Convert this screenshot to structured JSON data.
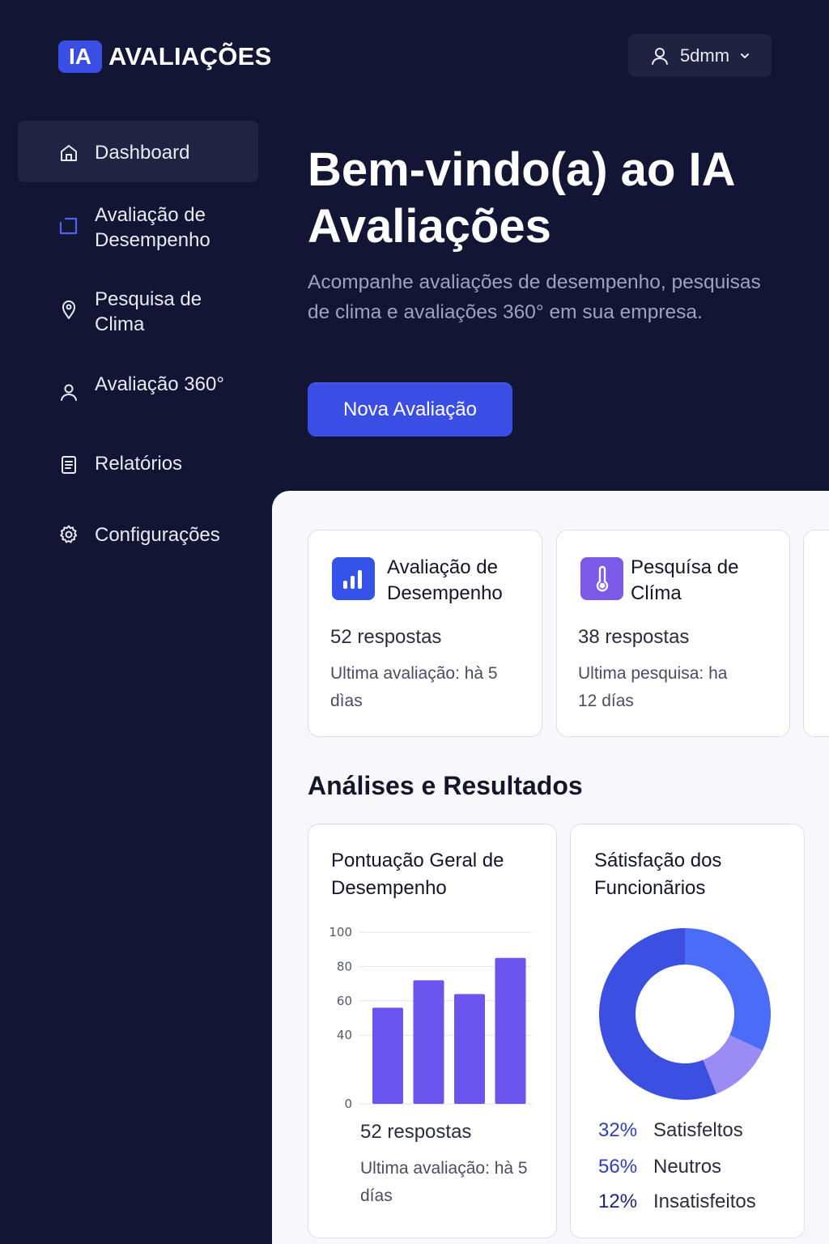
{
  "header": {
    "logo_badge": "IA",
    "logo_text": "AVALIAÇÕES",
    "user_name": "5dmm"
  },
  "sidebar": {
    "items": [
      {
        "label": "Dashboard",
        "icon": "home-icon",
        "active": true
      },
      {
        "label": "Avaliação de Desempenho",
        "icon": "rectangle-icon"
      },
      {
        "label": "Pesquisa de Clima",
        "icon": "location-pin-icon"
      },
      {
        "label": "Avaliação 360°",
        "icon": "user-icon"
      },
      {
        "label": "Relatórios",
        "icon": "document-icon"
      },
      {
        "label": "Configurações",
        "icon": "gear-icon"
      }
    ]
  },
  "hero": {
    "title": "Bem-vindo(a) ao IA Avaliações",
    "subtitle": "Acompanhe avaliações de desempenho, pesquisas de clima e avaliações 360° em sua empresa.",
    "cta_label": "Nova Avaliação"
  },
  "summary_cards": [
    {
      "title": "Avaliação de Desempenho",
      "count": "52 respostas",
      "meta": "Ultima avaliação: hà 5 dìas",
      "icon": "bar-chart-icon",
      "icon_color": "#3553e8"
    },
    {
      "title": "Pesquísa de Clíma",
      "count": "38 respostas",
      "meta": "Ultima pesquisa: ha 12 días",
      "icon": "thermometer-icon",
      "icon_color": "#7b5ae8"
    }
  ],
  "section_title": "Análises e Resultados",
  "performance_chart": {
    "title": "Pontuação Geral de Desempenho",
    "count": "52 respostas",
    "meta": "Ultima avaliação: hà 5 días"
  },
  "satisfaction_chart": {
    "title": "Sátisfação dos Funcionãrios",
    "legend": [
      {
        "pct": "32%",
        "label": "Satisfeltos"
      },
      {
        "pct": "56%",
        "label": "Neutros"
      },
      {
        "pct": "12%",
        "label": "Insatisfeitos"
      }
    ]
  },
  "chart_data": [
    {
      "type": "bar",
      "title": "Pontuação Geral de Desempenho",
      "categories": [
        "",
        "",
        "",
        ""
      ],
      "values": [
        56,
        72,
        64,
        85
      ],
      "ylim": [
        0,
        100
      ],
      "yticks": [
        "0",
        "40",
        "60",
        "80",
        "100"
      ],
      "bar_color": "#6c55ef",
      "grid": true
    },
    {
      "type": "pie",
      "title": "Sátisfação dos Funcionãrios",
      "donut": true,
      "slices": [
        {
          "label": "Satisfeltos",
          "value": 32,
          "color": "#4a6cf7"
        },
        {
          "label": "Insatisfeitos",
          "value": 12,
          "color": "#9b8cf5"
        },
        {
          "label": "Neutros",
          "value": 56,
          "color": "#3b4fe0"
        }
      ]
    }
  ]
}
